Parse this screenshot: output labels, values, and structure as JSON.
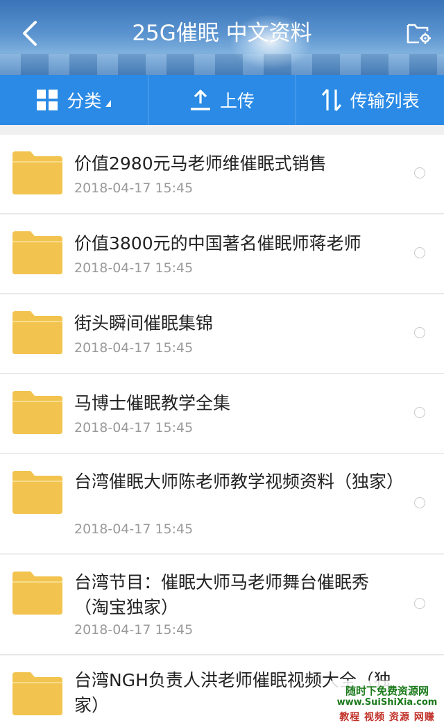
{
  "header": {
    "title": "25G催眠 中文资料",
    "back_icon": "chevron-left-icon",
    "settings_icon": "folder-settings-icon"
  },
  "toolbar": {
    "category_label": "分类",
    "upload_label": "上传",
    "transfer_label": "传输列表"
  },
  "files": [
    {
      "name": "价值2980元马老师维催眠式销售",
      "date": "2018-04-17   15:45"
    },
    {
      "name": "价值3800元的中国著名催眠师蒋老师",
      "date": "2018-04-17   15:45"
    },
    {
      "name": "街头瞬间催眠集锦",
      "date": "2018-04-17   15:45"
    },
    {
      "name": "马博士催眠教学全集",
      "date": "2018-04-17   15:45"
    },
    {
      "name": "台湾催眠大师陈老师教学视频资料（独家）",
      "date": "2018-04-17   15:45"
    },
    {
      "name": "台湾节目：催眠大师马老师舞台催眠秀（淘宝独家）",
      "date": "2018-04-17   15:45"
    },
    {
      "name": "台湾NGH负责人洪老师催眠视频大全（独家）",
      "date": ""
    }
  ],
  "watermark": {
    "line1": "随时下免费资源网",
    "line2": "www.SuiShiXia.com",
    "line3": "教程 视频 资源 网赚"
  },
  "colors": {
    "toolbar": "#2a8ae6",
    "folder": "#f2c44f",
    "header": "#4f86c2"
  }
}
